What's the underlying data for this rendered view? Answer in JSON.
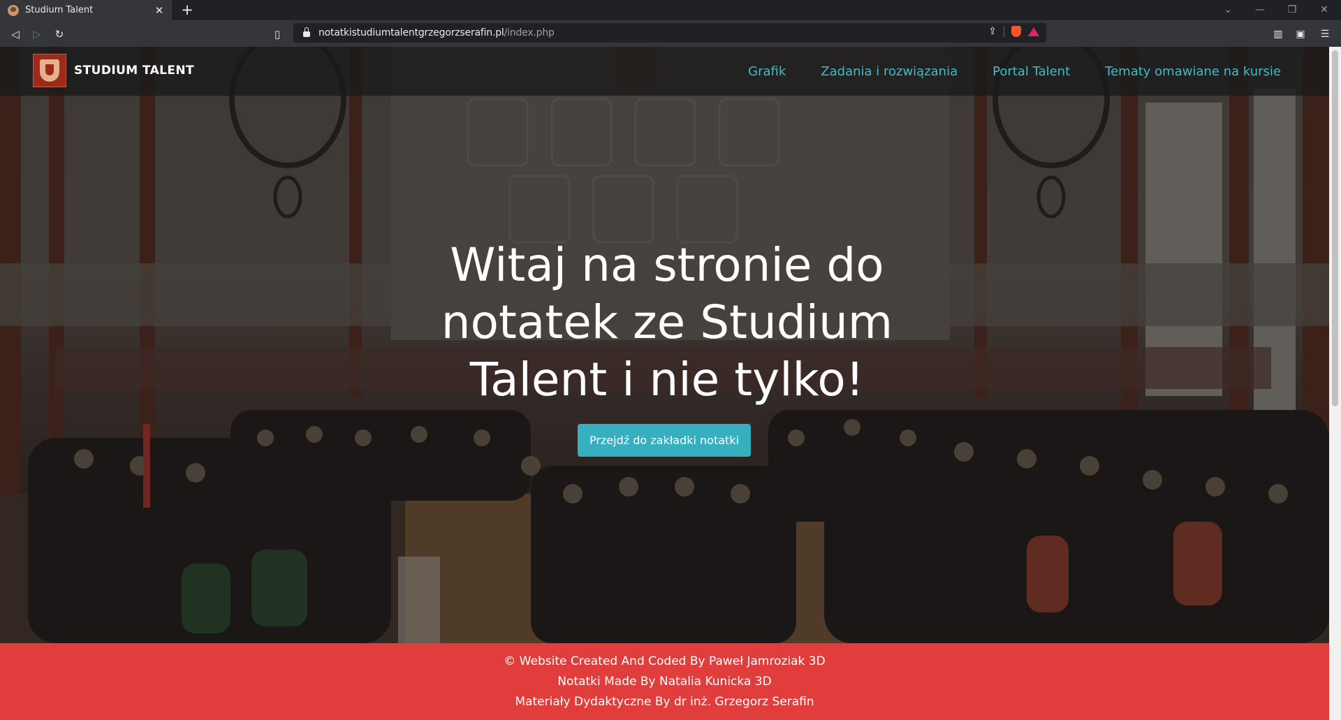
{
  "browser": {
    "tab_title": "Studium Talent",
    "tab_close": "✕",
    "new_tab": "+",
    "url_host": "notatkistudiumtalentgrzegorzserafin.pl",
    "url_path": "/index.php",
    "icons": {
      "back": "back-arrow-icon",
      "forward": "forward-arrow-icon",
      "reload": "reload-icon",
      "bookmark": "bookmark-icon",
      "lock": "lock-icon",
      "share": "share-icon",
      "brave": "brave-shield-icon",
      "rewards": "rewards-icon",
      "sidebar": "sidebar-icon",
      "wallet": "wallet-icon",
      "menu": "menu-icon"
    }
  },
  "site": {
    "brand_name": "STUDIUM TALENT",
    "nav": [
      {
        "label": "Grafik"
      },
      {
        "label": "Zadania i rozwiązania"
      },
      {
        "label": "Portal Talent"
      },
      {
        "label": "Tematy omawiane na kursie"
      }
    ],
    "hero": {
      "title": "Witaj na stronie do notatek ze Studium Talent i nie tylko!",
      "button": "Przejdź do zakładki notatki"
    },
    "footer": {
      "lines": [
        "© Website Created And Coded By Paweł Jamroziak 3D",
        "Notatki Made By Natalia Kunicka 3D",
        "Materiały Dydaktyczne By dr inż. Grzegorz Serafin"
      ]
    }
  },
  "colors": {
    "accent": "#40bbc8",
    "button": "#36b0bf",
    "footer": "#e13d3d"
  }
}
